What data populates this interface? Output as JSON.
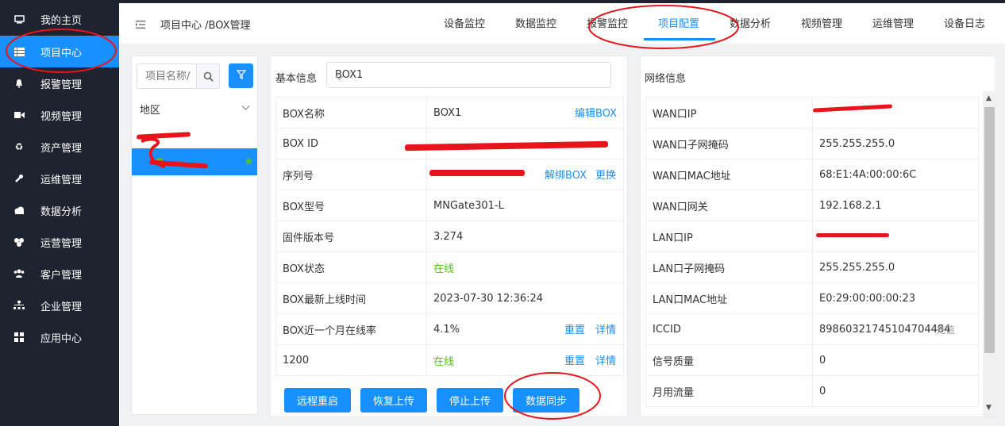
{
  "sidebar": {
    "items": [
      {
        "label": "我的主页",
        "icon": "monitor-icon"
      },
      {
        "label": "项目中心",
        "icon": "list-icon"
      },
      {
        "label": "报警管理",
        "icon": "bell-icon"
      },
      {
        "label": "视频管理",
        "icon": "video-icon"
      },
      {
        "label": "资产管理",
        "icon": "recycle-icon"
      },
      {
        "label": "运维管理",
        "icon": "wrench-icon"
      },
      {
        "label": "数据分析",
        "icon": "cloud-icon"
      },
      {
        "label": "运营管理",
        "icon": "cubes-icon"
      },
      {
        "label": "客户管理",
        "icon": "users-icon"
      },
      {
        "label": "企业管理",
        "icon": "sitemap-icon"
      },
      {
        "label": "应用中心",
        "icon": "grid-icon"
      }
    ],
    "active_index": 1
  },
  "header": {
    "breadcrumb": "项目中心 /BOX管理",
    "tabs": [
      "设备监控",
      "数据监控",
      "报警监控",
      "项目配置",
      "数据分析",
      "视频管理",
      "运维管理",
      "设备日志"
    ],
    "active_tab": "项目配置"
  },
  "left_panel": {
    "search_placeholder": "项目名称/",
    "region_label": "地区"
  },
  "basic_info": {
    "title": "基本信息",
    "box_select": "BOX1",
    "rows": [
      {
        "key": "BOX名称",
        "value": "BOX1",
        "actions": [
          "编辑BOX"
        ]
      },
      {
        "key": "BOX ID",
        "value": "",
        "actions": []
      },
      {
        "key": "序列号",
        "value": "",
        "actions": [
          "解绑BOX",
          "更换"
        ]
      },
      {
        "key": "BOX型号",
        "value": "MNGate301-L",
        "actions": []
      },
      {
        "key": "固件版本号",
        "value": "3.274",
        "actions": []
      },
      {
        "key": "BOX状态",
        "value": "在线",
        "actions": []
      },
      {
        "key": "BOX最新上线时间",
        "value": "2023-07-30 12:36:24",
        "actions": []
      },
      {
        "key": "BOX近一个月在线率",
        "value": "4.1%",
        "actions": [
          "重置",
          "详情"
        ]
      },
      {
        "key": "1200",
        "value": "在线",
        "actions": [
          "重置",
          "详情"
        ]
      }
    ],
    "buttons": [
      "远程重启",
      "恢复上传",
      "停止上传",
      "数据同步"
    ]
  },
  "network_info": {
    "title": "网络信息",
    "rows": [
      {
        "key": "WAN口IP",
        "value": ""
      },
      {
        "key": "WAN口子网掩码",
        "value": "255.255.255.0"
      },
      {
        "key": "WAN口MAC地址",
        "value": "68:E1:4A:00:00:6C"
      },
      {
        "key": "WAN口网关",
        "value": "192.168.2.1"
      },
      {
        "key": "LAN口IP",
        "value": ""
      },
      {
        "key": "LAN口子网掩码",
        "value": "255.255.255.0"
      },
      {
        "key": "LAN口MAC地址",
        "value": "E0:29:00:00:00:23"
      },
      {
        "key": "ICCID",
        "value": "89860321745104704484",
        "extra": "充值"
      },
      {
        "key": "信号质量",
        "value": "0"
      },
      {
        "key": "月用流量",
        "value": "0"
      }
    ]
  },
  "colors": {
    "primary": "#1890ff",
    "sidebar_bg": "#1f2330",
    "online": "#52c41a",
    "annotation": "#e8141c"
  }
}
